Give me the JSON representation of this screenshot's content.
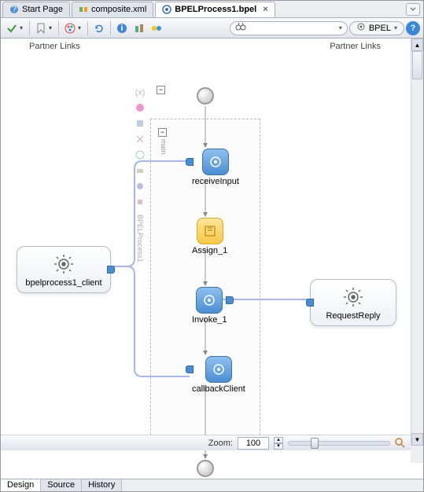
{
  "tabs": [
    {
      "label": "Start Page",
      "icon": "question-icon",
      "active": false
    },
    {
      "label": "composite.xml",
      "icon": "sca-icon",
      "active": false
    },
    {
      "label": "BPELProcess1.bpel",
      "icon": "bpel-icon",
      "active": true
    }
  ],
  "toolbar": {
    "search_placeholder": "",
    "bpel_label": "BPEL"
  },
  "partner_header_left": "Partner Links",
  "partner_header_right": "Partner Links",
  "partners": {
    "left": {
      "label": "bpelprocess1_client"
    },
    "right": {
      "label": "RequestReply"
    }
  },
  "scope": {
    "main_label": "main",
    "side_label": "BPELProcess1"
  },
  "flow": {
    "nodes": [
      {
        "id": "receiveInput",
        "label": "receiveInput",
        "type": "receive"
      },
      {
        "id": "assign1",
        "label": "Assign_1",
        "type": "assign"
      },
      {
        "id": "invoke1",
        "label": "Invoke_1",
        "type": "invoke"
      },
      {
        "id": "callbackClient",
        "label": "callbackClient",
        "type": "callback"
      }
    ]
  },
  "zoom": {
    "label": "Zoom:",
    "value": "100"
  },
  "bottom_tabs": [
    {
      "label": "Design",
      "active": true
    },
    {
      "label": "Source",
      "active": false
    },
    {
      "label": "History",
      "active": false
    }
  ],
  "colors": {
    "blue": "#4a8ed4",
    "yellow": "#f7c948",
    "wire": "#a9b7ea"
  }
}
